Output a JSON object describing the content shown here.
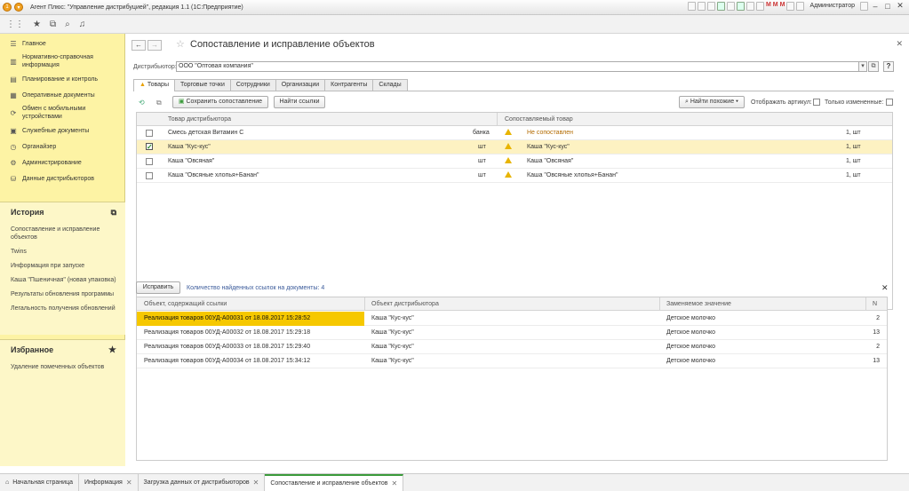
{
  "window": {
    "title": "Агент Плюс: \"Управление дистрибуцией\", редакция 1.1 (1С:Предприятие)",
    "user": "Администратор"
  },
  "sidebar": {
    "items": [
      {
        "label": "Главное",
        "icon": "menu-icon"
      },
      {
        "label": "Нормативно-справочная информация",
        "icon": "book-icon"
      },
      {
        "label": "Планирование и контроль",
        "icon": "chart-icon"
      },
      {
        "label": "Оперативные документы",
        "icon": "doc-icon"
      },
      {
        "label": "Обмен с мобильными устройствами",
        "icon": "sync-icon"
      },
      {
        "label": "Служебные документы",
        "icon": "folder-icon"
      },
      {
        "label": "Органайзер",
        "icon": "organizer-icon"
      },
      {
        "label": "Администрирование",
        "icon": "gear-icon"
      },
      {
        "label": "Данные дистрибьюторов",
        "icon": "data-icon"
      }
    ],
    "history": {
      "title": "История",
      "items": [
        "Сопоставление и исправление объектов",
        "Twins",
        "Информация при запуске",
        "Каша \"Пшеничная\" (новая упаковка)",
        "Результаты обновления программы",
        "Легальность получения обновлений"
      ]
    },
    "favorites": {
      "title": "Избранное",
      "items": [
        "Удаление помеченных объектов"
      ]
    }
  },
  "page": {
    "title": "Сопоставление и исправление объектов"
  },
  "distributor": {
    "label": "Дистрибьютор:",
    "value": "ООО \"Оптовая компания\""
  },
  "tabs": [
    "Товары",
    "Торговые точки",
    "Сотрудники",
    "Организации",
    "Контрагенты",
    "Склады"
  ],
  "toolbar": {
    "save": "Сохранить сопоставление",
    "find_links": "Найти ссылки",
    "find_similar": "Найти похожие",
    "show_article": "Отображать артикул:",
    "only_changed": "Только измененные:"
  },
  "goods": {
    "headers": [
      "Товар дистрибьютора",
      "Сопоставляемый товар"
    ],
    "rows": [
      {
        "checked": false,
        "name": "Смесь детская Витамин С",
        "unit": "банка",
        "match": "Не сопоставлен",
        "qty": "1, шт",
        "warn": true
      },
      {
        "checked": true,
        "name": "Каша \"Кус-кус\"",
        "unit": "шт",
        "match": "Каша \"Кус-кус\"",
        "qty": "1, шт",
        "warn": false
      },
      {
        "checked": false,
        "name": "Каша \"Овсяная\"",
        "unit": "шт",
        "match": "Каша \"Овсяная\"",
        "qty": "1, шт",
        "warn": false
      },
      {
        "checked": false,
        "name": "Каша \"Овсяные хлопья+Банан\"",
        "unit": "шт",
        "match": "Каша \"Овсяные хлопья+Банан\"",
        "qty": "1, шт",
        "warn": false
      }
    ]
  },
  "links": {
    "fix": "Исправить",
    "count": "Количество найденных ссылок на документы: 4",
    "headers": [
      "Объект, содержащий ссылки",
      "Объект дистрибьютора",
      "Заменяемое значение",
      "N"
    ],
    "rows": [
      {
        "doc": "Реализация товаров 00УД-А00031 от 18.08.2017 15:28:52",
        "obj": "Каша \"Кус-кус\"",
        "val": "Детское молочко",
        "n": "2"
      },
      {
        "doc": "Реализация товаров 00УД-А00032 от 18.08.2017 15:29:18",
        "obj": "Каша \"Кус-кус\"",
        "val": "Детское молочко",
        "n": "13"
      },
      {
        "doc": "Реализация товаров 00УД-А00033 от 18.08.2017 15:29:40",
        "obj": "Каша \"Кус-кус\"",
        "val": "Детское молочко",
        "n": "2"
      },
      {
        "doc": "Реализация товаров 00УД-А00034 от 18.08.2017 15:34:12",
        "obj": "Каша \"Кус-кус\"",
        "val": "Детское молочко",
        "n": "13"
      }
    ]
  },
  "statusbar": {
    "tabs": [
      "Начальная страница",
      "Информация",
      "Загрузка данных от дистрибьюторов",
      "Сопоставление и исправление объектов"
    ]
  }
}
